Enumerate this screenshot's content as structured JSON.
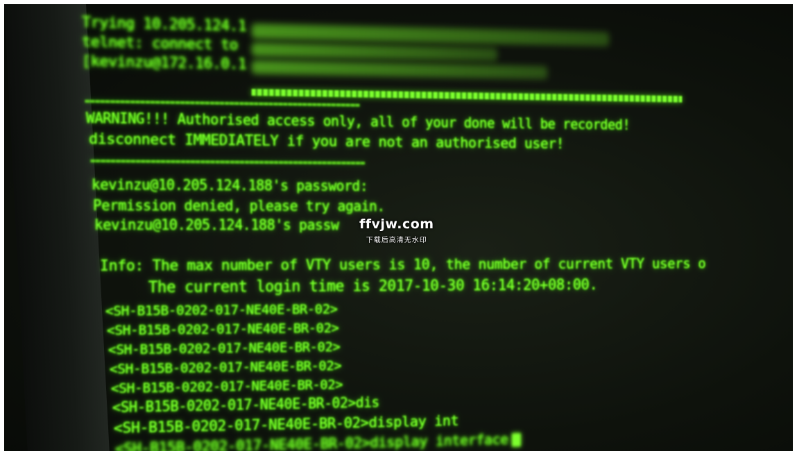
{
  "terminal": {
    "lines": [
      "Trying 10.205.124.1",
      "telnet: connect to",
      "[kevinzu@172.16.0.1",
      "========================================================",
      "WARNING!!! Authorised access only, all of your done will be recorded!",
      "disconnect IMMEDIATELY if you are not an authorised user!",
      "========================================================",
      "kevinzu@10.205.124.188's password:",
      "Permission denied, please try again.",
      "kevinzu@10.205.124.188's passw",
      "Info: The max number of VTY users is 10, the number of current VTY users o",
      "     The current login time is 2017-10-30 16:14:20+08:00.",
      "<SH-B15B-0202-017-NE40E-BR-02>",
      "<SH-B15B-0202-017-NE40E-BR-02>",
      "<SH-B15B-0202-017-NE40E-BR-02>",
      "<SH-B15B-0202-017-NE40E-BR-02>",
      "<SH-B15B-0202-017-NE40E-BR-02>",
      "<SH-B15B-0202-017-NE40E-BR-02>dis",
      "<SH-B15B-0202-017-NE40E-BR-02>display int",
      "<SH-B15B-0202-017-NE40E-BR-02>display interface"
    ]
  },
  "watermark": {
    "main": "ffvjw.com",
    "sub": "下载后高清无水印"
  },
  "colors": {
    "terminal_text": "#7dff2e",
    "background": "#0e120c"
  }
}
